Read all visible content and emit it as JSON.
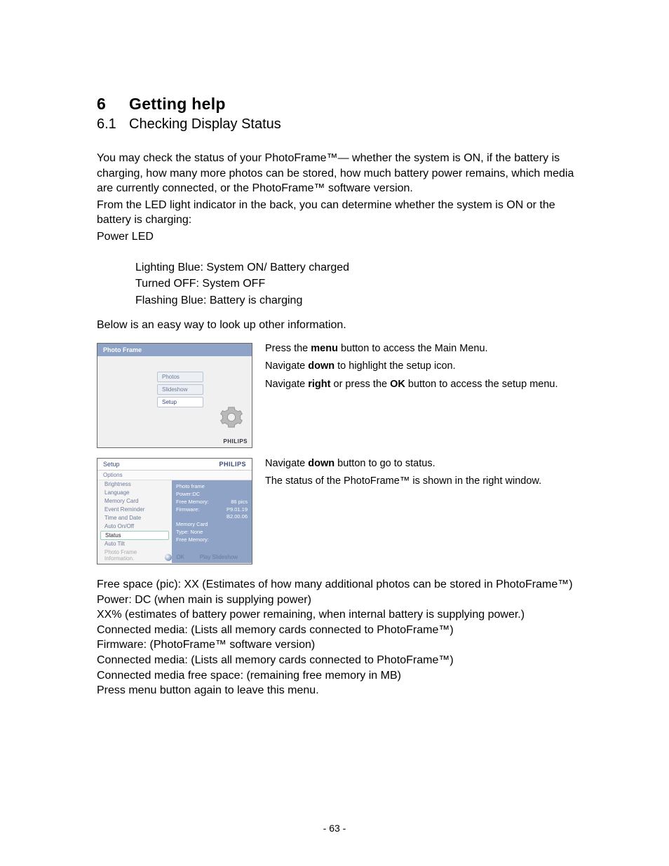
{
  "heading": {
    "num": "6",
    "title": "Getting help"
  },
  "subheading": {
    "num": "6.1",
    "title": "Checking Display Status"
  },
  "intro": {
    "p1": "You may check the status of your PhotoFrame™— whether the system is ON, if the battery is charging, how many more photos can be stored, how much battery power remains, which media are currently connected, or the PhotoFrame™ software version.",
    "p2": "From the LED light indicator in the back, you can determine whether the system is ON or the battery is charging:",
    "p3": "Power LED"
  },
  "led": {
    "l1": "Lighting Blue: System ON/ Battery charged",
    "l2": "Turned OFF: System OFF",
    "l3": "Flashing Blue: Battery is charging"
  },
  "below": "Below is an easy way to look up other information.",
  "ss1": {
    "title": "Photo Frame",
    "menu": [
      "Photos",
      "Slideshow",
      "Setup"
    ],
    "brand": "PHILIPS"
  },
  "instr1": {
    "a_pre": "Press the ",
    "a_b": "menu",
    "a_post": " button to access the Main Menu.",
    "b_pre": "Navigate ",
    "b_b": "down",
    "b_post": " to highlight the setup icon.",
    "c_pre": "Navigate ",
    "c_b1": "right",
    "c_mid": " or press the ",
    "c_b2": "OK",
    "c_post": " button to access the setup menu."
  },
  "ss2": {
    "head_left": "Setup",
    "brand": "PHILIPS",
    "options": "Options",
    "left": [
      "Brightness",
      "Language",
      "Memory Card",
      "Event Reminder",
      "Time and Date",
      "Auto On/Off",
      "Status",
      "Auto Tilt",
      "Photo Frame Information."
    ],
    "selected_index": 6,
    "right": {
      "r1l": "Photo frame",
      "r1r": "",
      "r2l": "Power:DC",
      "r2r": "",
      "r3l": "Free Memory:",
      "r3r": "86  pics",
      "r4l": "Firmware:",
      "r4r": "P9.01.19",
      "r5l": "",
      "r5r": "B2.00.06",
      "r6l": "Memory Card",
      "r6r": "",
      "r7l": "Type: None",
      "r7r": "",
      "r8l": "Free Memory:",
      "r8r": ""
    },
    "footer_play": "Play Slideshow",
    "footer_ok": "OK"
  },
  "instr2": {
    "a_pre": "Navigate ",
    "a_b": "down",
    "a_post": " button to go to status.",
    "b": "The status of the PhotoFrame™ is shown in the right window."
  },
  "info": {
    "l1": "Free space (pic): XX (Estimates of how many additional photos can be stored in PhotoFrame™)",
    "l2": "Power:  DC (when main is supplying power)",
    "l3": "XX% (estimates of battery power remaining, when internal battery is supplying power.)",
    "l4": "Connected media: (Lists all memory cards connected to PhotoFrame™)",
    "l5": "Firmware: (PhotoFrame™ software version)",
    "l6": "Connected media: (Lists all memory cards connected to PhotoFrame™)",
    "l7": "Connected media free space: (remaining free memory in MB)"
  },
  "closing": "Press menu button again to leave this menu.",
  "page_number": "- 63 -"
}
